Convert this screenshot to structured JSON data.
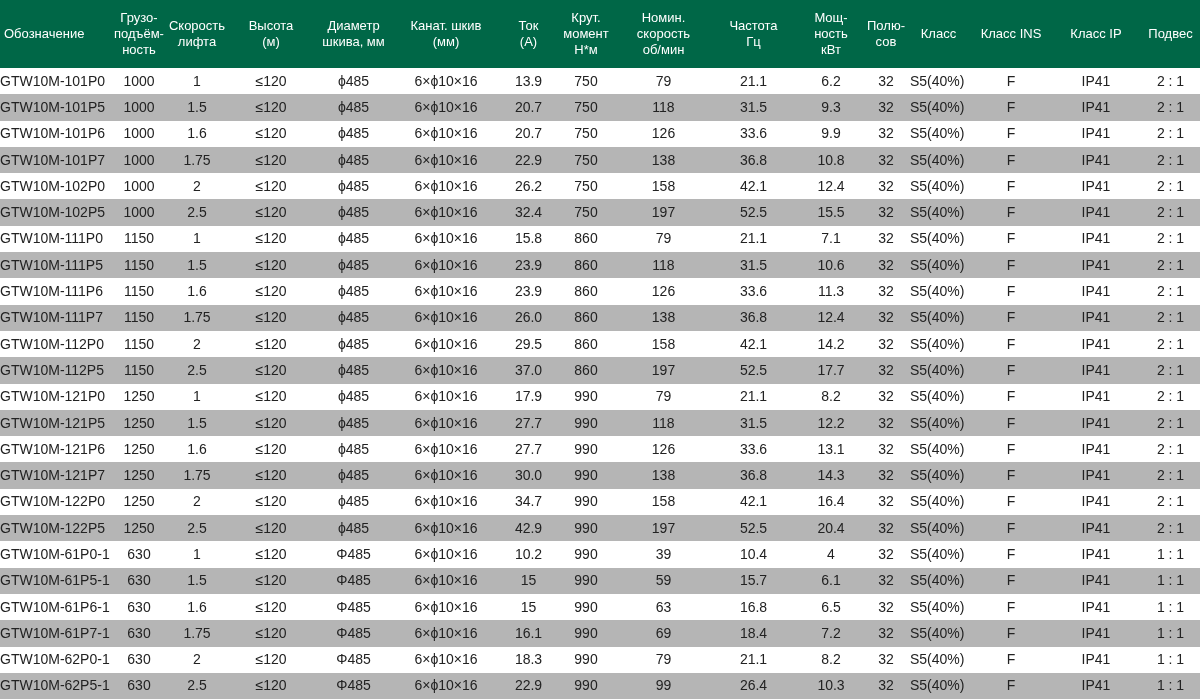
{
  "table": {
    "columns": [
      {
        "lines": [
          "Обозначение"
        ]
      },
      {
        "lines": [
          "Грузо-",
          "подъём-",
          "ность"
        ]
      },
      {
        "lines": [
          "Скорость",
          "лифта"
        ]
      },
      {
        "lines": [
          "Высота",
          "(м)"
        ]
      },
      {
        "lines": [
          "Диаметр",
          "шкива, мм"
        ]
      },
      {
        "lines": [
          "Канат. шкив",
          "(мм)"
        ]
      },
      {
        "lines": [
          "Ток",
          "(А)"
        ]
      },
      {
        "lines": [
          "Крут.",
          "момент",
          "Н*м"
        ]
      },
      {
        "lines": [
          "Номин.",
          "скорость",
          "об/мин"
        ]
      },
      {
        "lines": [
          "Частота",
          "Гц"
        ]
      },
      {
        "lines": [
          "Мощ-",
          "ность",
          "кВт"
        ]
      },
      {
        "lines": [
          "Полю-",
          "сов"
        ]
      },
      {
        "lines": [
          "Класс"
        ]
      },
      {
        "lines": [
          "Класс INS"
        ]
      },
      {
        "lines": [
          "Класс IP"
        ]
      },
      {
        "lines": [
          "Подвес"
        ]
      }
    ],
    "rows": [
      [
        "GTW10M-101P0",
        "1000",
        "1",
        "≤120",
        "ϕ485",
        "6×ϕ10×16",
        "13.9",
        "750",
        "79",
        "21.1",
        "6.2",
        "32",
        "S5(40%)",
        "F",
        "IP41",
        "2 : 1"
      ],
      [
        "GTW10M-101P5",
        "1000",
        "1.5",
        "≤120",
        "ϕ485",
        "6×ϕ10×16",
        "20.7",
        "750",
        "118",
        "31.5",
        "9.3",
        "32",
        "S5(40%)",
        "F",
        "IP41",
        "2 : 1"
      ],
      [
        "GTW10M-101P6",
        "1000",
        "1.6",
        "≤120",
        "ϕ485",
        "6×ϕ10×16",
        "20.7",
        "750",
        "126",
        "33.6",
        "9.9",
        "32",
        "S5(40%)",
        "F",
        "IP41",
        "2 : 1"
      ],
      [
        "GTW10M-101P7",
        "1000",
        "1.75",
        "≤120",
        "ϕ485",
        "6×ϕ10×16",
        "22.9",
        "750",
        "138",
        "36.8",
        "10.8",
        "32",
        "S5(40%)",
        "F",
        "IP41",
        "2 : 1"
      ],
      [
        "GTW10M-102P0",
        "1000",
        "2",
        "≤120",
        "ϕ485",
        "6×ϕ10×16",
        "26.2",
        "750",
        "158",
        "42.1",
        "12.4",
        "32",
        "S5(40%)",
        "F",
        "IP41",
        "2 : 1"
      ],
      [
        "GTW10M-102P5",
        "1000",
        "2.5",
        "≤120",
        "ϕ485",
        "6×ϕ10×16",
        "32.4",
        "750",
        "197",
        "52.5",
        "15.5",
        "32",
        "S5(40%)",
        "F",
        "IP41",
        "2 : 1"
      ],
      [
        "GTW10M-111P0",
        "1150",
        "1",
        "≤120",
        "ϕ485",
        "6×ϕ10×16",
        "15.8",
        "860",
        "79",
        "21.1",
        "7.1",
        "32",
        "S5(40%)",
        "F",
        "IP41",
        "2 : 1"
      ],
      [
        "GTW10M-111P5",
        "1150",
        "1.5",
        "≤120",
        "ϕ485",
        "6×ϕ10×16",
        "23.9",
        "860",
        "118",
        "31.5",
        "10.6",
        "32",
        "S5(40%)",
        "F",
        "IP41",
        "2 : 1"
      ],
      [
        "GTW10M-111P6",
        "1150",
        "1.6",
        "≤120",
        "ϕ485",
        "6×ϕ10×16",
        "23.9",
        "860",
        "126",
        "33.6",
        "11.3",
        "32",
        "S5(40%)",
        "F",
        "IP41",
        "2 : 1"
      ],
      [
        "GTW10M-111P7",
        "1150",
        "1.75",
        "≤120",
        "ϕ485",
        "6×ϕ10×16",
        "26.0",
        "860",
        "138",
        "36.8",
        "12.4",
        "32",
        "S5(40%)",
        "F",
        "IP41",
        "2 : 1"
      ],
      [
        "GTW10M-112P0",
        "1150",
        "2",
        "≤120",
        "ϕ485",
        "6×ϕ10×16",
        "29.5",
        "860",
        "158",
        "42.1",
        "14.2",
        "32",
        "S5(40%)",
        "F",
        "IP41",
        "2 : 1"
      ],
      [
        "GTW10M-112P5",
        "1150",
        "2.5",
        "≤120",
        "ϕ485",
        "6×ϕ10×16",
        "37.0",
        "860",
        "197",
        "52.5",
        "17.7",
        "32",
        "S5(40%)",
        "F",
        "IP41",
        "2 : 1"
      ],
      [
        "GTW10M-121P0",
        "1250",
        "1",
        "≤120",
        "ϕ485",
        "6×ϕ10×16",
        "17.9",
        "990",
        "79",
        "21.1",
        "8.2",
        "32",
        "S5(40%)",
        "F",
        "IP41",
        "2 : 1"
      ],
      [
        "GTW10M-121P5",
        "1250",
        "1.5",
        "≤120",
        "ϕ485",
        "6×ϕ10×16",
        "27.7",
        "990",
        "118",
        "31.5",
        "12.2",
        "32",
        "S5(40%)",
        "F",
        "IP41",
        "2 : 1"
      ],
      [
        "GTW10M-121P6",
        "1250",
        "1.6",
        "≤120",
        "ϕ485",
        "6×ϕ10×16",
        "27.7",
        "990",
        "126",
        "33.6",
        "13.1",
        "32",
        "S5(40%)",
        "F",
        "IP41",
        "2 : 1"
      ],
      [
        "GTW10M-121P7",
        "1250",
        "1.75",
        "≤120",
        "ϕ485",
        "6×ϕ10×16",
        "30.0",
        "990",
        "138",
        "36.8",
        "14.3",
        "32",
        "S5(40%)",
        "F",
        "IP41",
        "2 : 1"
      ],
      [
        "GTW10M-122P0",
        "1250",
        "2",
        "≤120",
        "ϕ485",
        "6×ϕ10×16",
        "34.7",
        "990",
        "158",
        "42.1",
        "16.4",
        "32",
        "S5(40%)",
        "F",
        "IP41",
        "2 : 1"
      ],
      [
        "GTW10M-122P5",
        "1250",
        "2.5",
        "≤120",
        "ϕ485",
        "6×ϕ10×16",
        "42.9",
        "990",
        "197",
        "52.5",
        "20.4",
        "32",
        "S5(40%)",
        "F",
        "IP41",
        "2 : 1"
      ],
      [
        "GTW10M-61P0-1",
        "630",
        "1",
        "≤120",
        "Φ485",
        "6×ϕ10×16",
        "10.2",
        "990",
        "39",
        "10.4",
        "4",
        "32",
        "S5(40%)",
        "F",
        "IP41",
        "1 : 1"
      ],
      [
        "GTW10M-61P5-1",
        "630",
        "1.5",
        "≤120",
        "Φ485",
        "6×ϕ10×16",
        "15",
        "990",
        "59",
        "15.7",
        "6.1",
        "32",
        "S5(40%)",
        "F",
        "IP41",
        "1 : 1"
      ],
      [
        "GTW10M-61P6-1",
        "630",
        "1.6",
        "≤120",
        "Φ485",
        "6×ϕ10×16",
        "15",
        "990",
        "63",
        "16.8",
        "6.5",
        "32",
        "S5(40%)",
        "F",
        "IP41",
        "1 : 1"
      ],
      [
        "GTW10M-61P7-1",
        "630",
        "1.75",
        "≤120",
        "Φ485",
        "6×ϕ10×16",
        "16.1",
        "990",
        "69",
        "18.4",
        "7.2",
        "32",
        "S5(40%)",
        "F",
        "IP41",
        "1 : 1"
      ],
      [
        "GTW10M-62P0-1",
        "630",
        "2",
        "≤120",
        "Φ485",
        "6×ϕ10×16",
        "18.3",
        "990",
        "79",
        "21.1",
        "8.2",
        "32",
        "S5(40%)",
        "F",
        "IP41",
        "1 : 1"
      ],
      [
        "GTW10M-62P5-1",
        "630",
        "2.5",
        "≤120",
        "Φ485",
        "6×ϕ10×16",
        "22.9",
        "990",
        "99",
        "26.4",
        "10.3",
        "32",
        "S5(40%)",
        "F",
        "IP41",
        "1 : 1"
      ]
    ]
  }
}
